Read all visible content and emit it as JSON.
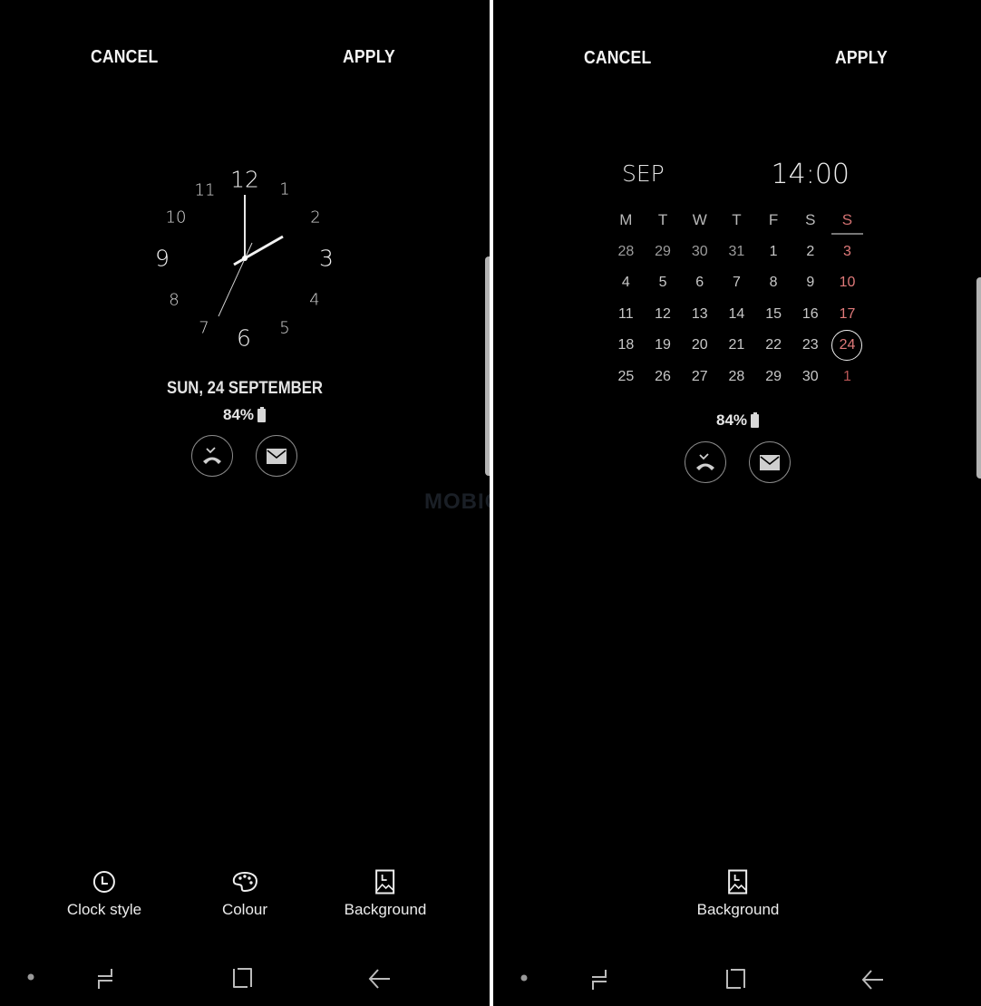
{
  "left_panel": {
    "cancel_label": "CANCEL",
    "apply_label": "APPLY",
    "clock": {
      "numerals": [
        "12",
        "1",
        "2",
        "3",
        "4",
        "5",
        "6",
        "7",
        "8",
        "9",
        "10",
        "11"
      ],
      "time_shown": "14:00 (analog)"
    },
    "date_label": "SUN, 24 SEPTEMBER",
    "battery_label": "84%",
    "notifications": [
      {
        "icon": "missed-call-icon"
      },
      {
        "icon": "mail-icon"
      }
    ],
    "options": [
      {
        "label": "Clock style",
        "icon": "clock-icon"
      },
      {
        "label": "Colour",
        "icon": "palette-icon"
      },
      {
        "label": "Background",
        "icon": "image-icon"
      }
    ]
  },
  "right_panel": {
    "cancel_label": "CANCEL",
    "apply_label": "APPLY",
    "month_label": "SEP",
    "time_label": "14:00",
    "weekdays": [
      "M",
      "T",
      "W",
      "T",
      "F",
      "S",
      "S"
    ],
    "weeks": [
      [
        "28",
        "29",
        "30",
        "31",
        "1",
        "2",
        "3"
      ],
      [
        "4",
        "5",
        "6",
        "7",
        "8",
        "9",
        "10"
      ],
      [
        "11",
        "12",
        "13",
        "14",
        "15",
        "16",
        "17"
      ],
      [
        "18",
        "19",
        "20",
        "21",
        "22",
        "23",
        "24"
      ],
      [
        "25",
        "26",
        "27",
        "28",
        "29",
        "30",
        "1"
      ]
    ],
    "today": "24",
    "battery_label": "84%",
    "notifications": [
      {
        "icon": "missed-call-icon"
      },
      {
        "icon": "mail-icon"
      }
    ],
    "options": [
      {
        "label": "Background",
        "icon": "image-icon"
      }
    ]
  },
  "watermark": "MOBIGYAAN",
  "colors": {
    "background": "#000000",
    "sunday_accent": "#e07a7a",
    "divider": "#ffffff"
  }
}
